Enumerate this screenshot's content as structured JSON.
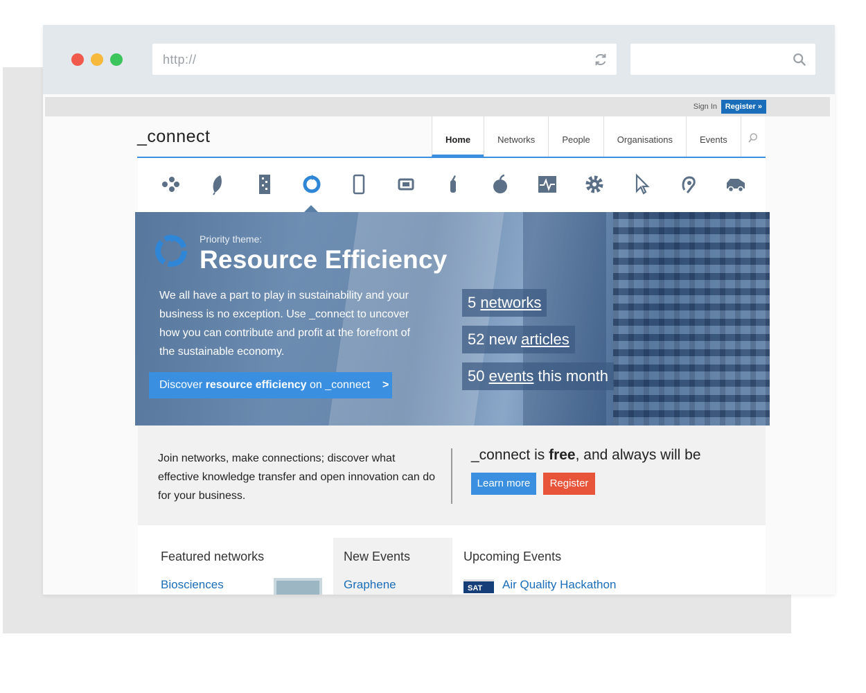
{
  "browser": {
    "url": "http://",
    "colors": {
      "close": "#f05a4c",
      "minimize": "#f6b93b",
      "maximize": "#3cc55c"
    }
  },
  "site": {
    "topbar": {
      "sign_in": "Sign In",
      "register": "Register »"
    },
    "logo": "_connect",
    "nav": [
      "Home",
      "Networks",
      "People",
      "Organisations",
      "Events"
    ],
    "categories": [
      "molecule-icon",
      "leaf-icon",
      "circuit-board-icon",
      "recycle-icon",
      "mobile-phone-icon",
      "chip-icon",
      "pipette-icon",
      "apple-icon",
      "heartbeat-monitor-icon",
      "gear-icon",
      "cursor-icon",
      "hearing-icon",
      "truck-icon"
    ],
    "hero": {
      "kicker": "Priority theme:",
      "title": "Resource Efficiency",
      "body": "We all have a part to play in sustainability and your business is no exception. Use _connect to uncover how you can contribute and profit at the forefront of the sustainable economy.",
      "cta_pre": "Discover ",
      "cta_bold": "resource efficiency",
      "cta_post": " on _connect",
      "cta_arrow": ">",
      "stats": [
        {
          "num": "5",
          "pre": " ",
          "link": "networks",
          "post": ""
        },
        {
          "num": "52",
          "pre": " new ",
          "link": "articles",
          "post": ""
        },
        {
          "num": "50",
          "pre": " ",
          "link": "events",
          "post": " this month"
        }
      ]
    },
    "promo": {
      "text": "Join networks, make connections; discover what effective knowledge transfer and open innovation can do for your business.",
      "free_pre": "_connect is ",
      "free_bold": "free",
      "free_post": ", and always will be",
      "learn_more": "Learn more",
      "register": "Register"
    },
    "lower": {
      "featured_title": "Featured networks",
      "featured_link": "Biosciences",
      "new_events_title": "New Events",
      "new_events_link": "Graphene",
      "upcoming_title": "Upcoming Events",
      "upcoming_day": "SAT",
      "upcoming_link": "Air Quality Hackathon"
    },
    "colors": {
      "accent": "#3a8fe0",
      "register": "#e8543a",
      "link": "#1a6db8"
    }
  }
}
